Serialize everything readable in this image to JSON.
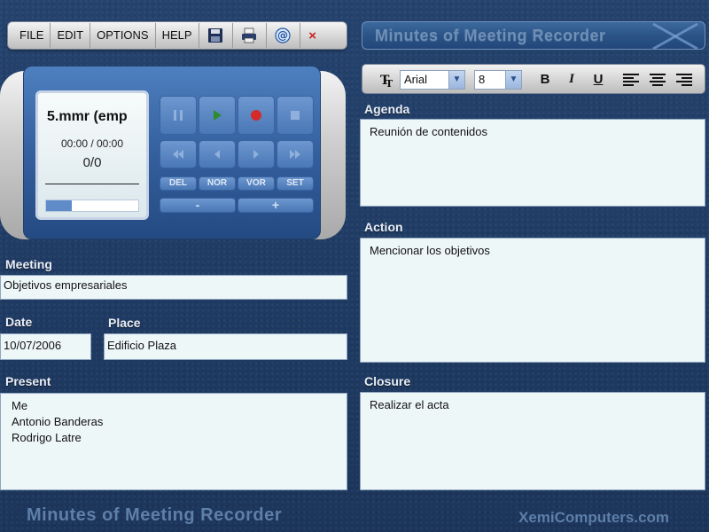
{
  "menu": {
    "items": [
      {
        "label": "FILE"
      },
      {
        "label": "EDIT"
      },
      {
        "label": "OPTIONS"
      },
      {
        "label": "HELP"
      }
    ],
    "icons": [
      "save-icon",
      "print-icon",
      "email-icon",
      "close-icon"
    ],
    "close_label": "×"
  },
  "app_title": "Minutes of Meeting Recorder",
  "player": {
    "filename": "5.mmr  (emp",
    "time": "00:00 / 00:00",
    "count": "0/0",
    "progress": 0.28,
    "buttons": {
      "del": "DEL",
      "nor": "NOR",
      "vor": "VOR",
      "set": "SET",
      "vol_down": "-",
      "vol_up": "+"
    },
    "accent": "#2e8b2e",
    "record_color": "#d42a2a"
  },
  "meeting": {
    "label": "Meeting",
    "value": "Objetivos empresariales"
  },
  "date": {
    "label": "Date",
    "value": "10/07/2006"
  },
  "place": {
    "label": "Place",
    "value": "Edificio Plaza"
  },
  "present": {
    "label": "Present",
    "lines": [
      "Me",
      "Antonio Banderas",
      "Rodrigo Latre"
    ]
  },
  "format": {
    "font": "Arial",
    "size": "8",
    "bold": "B",
    "italic": "I",
    "underline": "U"
  },
  "agenda": {
    "label": "Agenda",
    "value": "Reunión de contenidos"
  },
  "action": {
    "label": "Action",
    "value": "Mencionar los objetivos"
  },
  "closure": {
    "label": "Closure",
    "value": "Realizar el acta"
  },
  "footer": {
    "title": "Minutes of Meeting Recorder",
    "brand": "XemiComputers.com"
  }
}
